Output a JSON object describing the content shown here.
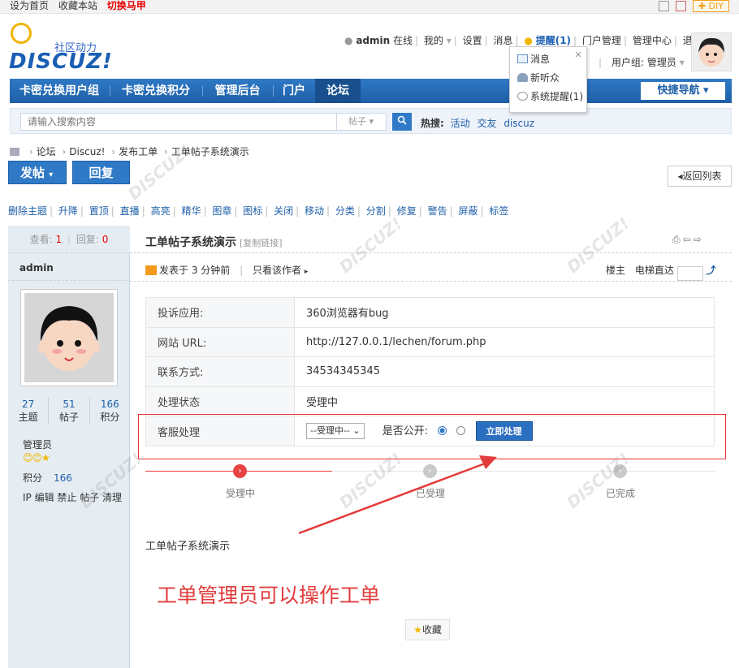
{
  "topbar": {
    "links": [
      "设为首页",
      "收藏本站"
    ],
    "switch": "切换马甲",
    "diy": "DIY"
  },
  "logo": {
    "slogan": "社区动力",
    "brand": "DISCUZ!"
  },
  "userbar": {
    "username": "admin",
    "online": "在线",
    "mine": "我的",
    "settings": "设置",
    "messages": "消息",
    "remind": "提醒(1)",
    "portal_admin": "门户管理",
    "admin_center": "管理中心",
    "logout": "退出",
    "usergroup": "用户组: 管理员"
  },
  "dropdown": {
    "items": [
      "消息",
      "新听众",
      "系统提醒(1)"
    ],
    "close": "×"
  },
  "nav": {
    "items": [
      "卡密兑换用户组",
      "卡密兑换积分",
      "管理后台",
      "门户",
      "论坛"
    ],
    "quick": "快捷导航"
  },
  "search": {
    "placeholder": "请输入搜索内容",
    "type": "帖子",
    "hot_label": "热搜:",
    "hot": [
      "活动",
      "交友",
      "discuz"
    ]
  },
  "breadcrumb": [
    "论坛",
    "Discuz!",
    "发布工单",
    "工单帖子系统演示"
  ],
  "buttons": {
    "post": "发帖",
    "reply": "回复",
    "back": "返回列表"
  },
  "modbar": [
    "删除主题",
    "升降",
    "置顶",
    "直播",
    "高亮",
    "精华",
    "图章",
    "图标",
    "关闭",
    "移动",
    "分类",
    "分割",
    "修复",
    "警告",
    "屏蔽",
    "标签"
  ],
  "thread": {
    "views_label": "查看:",
    "views": "1",
    "replies_label": "回复:",
    "replies": "0",
    "title": "工单帖子系统演示",
    "copy": "[复制链接]",
    "author": "admin",
    "posted": "发表于 3 分钟前",
    "only_author": "只看该作者",
    "floor": "楼主",
    "elevator": "电梯直达"
  },
  "profile": {
    "stats": [
      {
        "n": "27",
        "l": "主题"
      },
      {
        "n": "51",
        "l": "帖子"
      },
      {
        "n": "166",
        "l": "积分"
      }
    ],
    "group": "管理员",
    "credit_label": "积分",
    "credit": "166",
    "actions": "IP 编辑 禁止 帖子 清理"
  },
  "ticket": {
    "rows": [
      {
        "k": "投诉应用:",
        "v": "360浏览器有bug"
      },
      {
        "k": "网站 URL:",
        "v": "http://127.0.0.1/lechen/forum.php"
      },
      {
        "k": "联系方式:",
        "v": "34534345345"
      },
      {
        "k": "处理状态",
        "v": "受理中"
      }
    ],
    "handle_label": "客服处理",
    "select": "--受理中--",
    "public_label": "是否公开:",
    "submit": "立即处理"
  },
  "progress": {
    "steps": [
      "受理中",
      "已受理",
      "已完成"
    ],
    "current": 1
  },
  "content": {
    "body": "工单帖子系统演示",
    "note": "工单管理员可以操作工单",
    "favorite": "收藏"
  },
  "colors": {
    "nav_blue": "#2f79c6",
    "accent_red": "#e23c3c"
  }
}
